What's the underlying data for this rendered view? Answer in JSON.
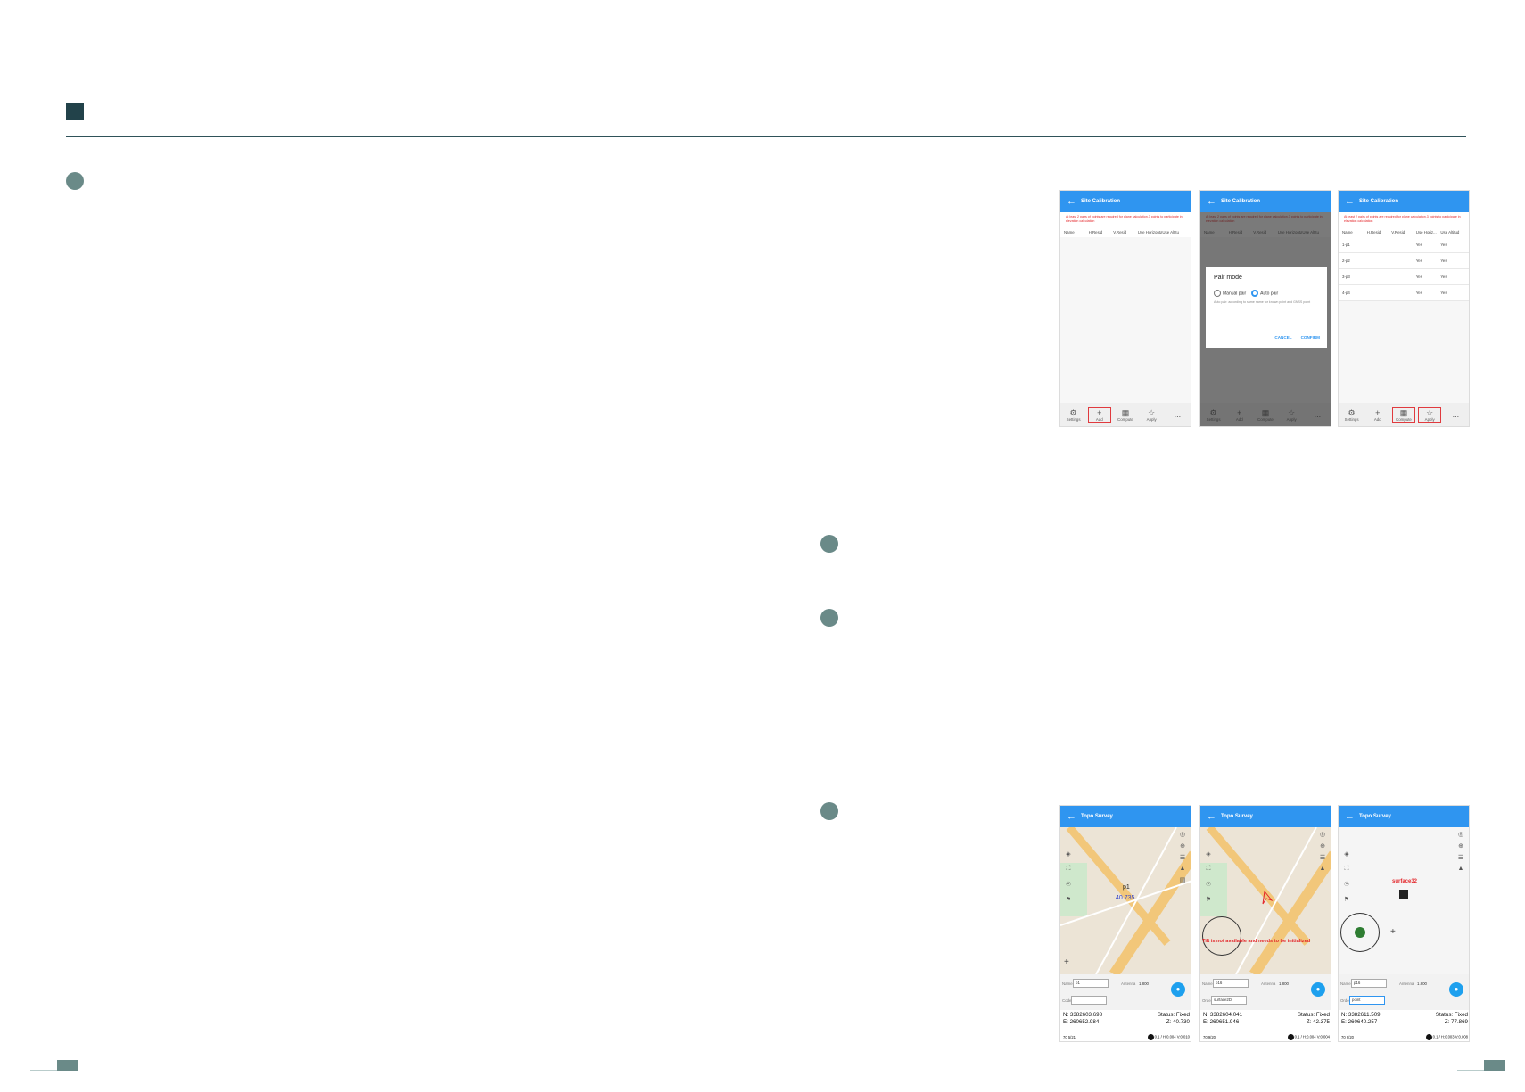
{
  "colors": {
    "accent": "#2f95f0",
    "warning": "#e3262a",
    "bullet": "#6a8a88",
    "header": "#22424a"
  },
  "site_calibration": {
    "title": "Site Calibration",
    "back_icon": "arrow-left-icon",
    "warning": "At least 2 pairs of points are required for plane calculation,3 points to participate in elevation calculation",
    "columns": [
      "Name",
      "H.Resid",
      "V.Resid",
      "Use Horizontal",
      "Use Altitu"
    ],
    "columns_short": [
      "Name",
      "H.Resid",
      "V.Resid",
      "Use Horiz...",
      "Use Altitud"
    ],
    "rows": [
      {
        "name": "1-p1",
        "h": "Yes",
        "v": "Yes"
      },
      {
        "name": "2-p2",
        "h": "Yes",
        "v": "Yes"
      },
      {
        "name": "3-p3",
        "h": "Yes",
        "v": "Yes"
      },
      {
        "name": "4-p4",
        "h": "Yes",
        "v": "Yes"
      }
    ],
    "toolbar": {
      "settings": "Settings",
      "add": "Add",
      "compute": "Compute",
      "apply": "Apply",
      "more": "..."
    }
  },
  "pair_dialog": {
    "title": "Pair mode",
    "manual": "Manual pair",
    "auto": "Auto pair",
    "desc": "Auto pair: according to same name for known point and GNSS point",
    "cancel": "CANCEL",
    "confirm": "CONFIRM"
  },
  "topo": {
    "title": "Topo Survey",
    "screens": [
      {
        "name_label": "Name",
        "name": "p1",
        "antenna_label": "Antenna",
        "antenna": "1.800",
        "code_label": "Code",
        "code": "",
        "n": "N: 3382603.698",
        "e": "E: 260652.984",
        "status": "Status: Fixed",
        "z": "Z: 40.730",
        "bl": "70  5/21",
        "br": "0.1 / H:0.004 V:0.010",
        "map_label": "p1",
        "map_value": "40.735"
      },
      {
        "name_label": "Name",
        "name": "p16",
        "antenna_label": "Antenna",
        "antenna": "1.800",
        "code_label": "Order",
        "code": "surface2D",
        "n": "N: 3382604.041",
        "e": "E: 260651.946",
        "status": "Status: Fixed",
        "z": "Z: 42.375",
        "bl": "70  9/20",
        "br": "0.1 / H:0.004 V:0.004",
        "map_warning": "Tilt is not available and needs to be initialized"
      },
      {
        "name_label": "Name",
        "name": "p16",
        "antenna_label": "Antenna",
        "antenna": "1.800",
        "code_label": "Order",
        "code": "point",
        "n": "N: 3382611.509",
        "e": "E: 260640.257",
        "status": "Status: Fixed",
        "z": "Z: 77.869",
        "bl": "70  9/20",
        "br": "0.1 / H:0.003 V:0.008",
        "map_label": "surface32"
      }
    ]
  }
}
